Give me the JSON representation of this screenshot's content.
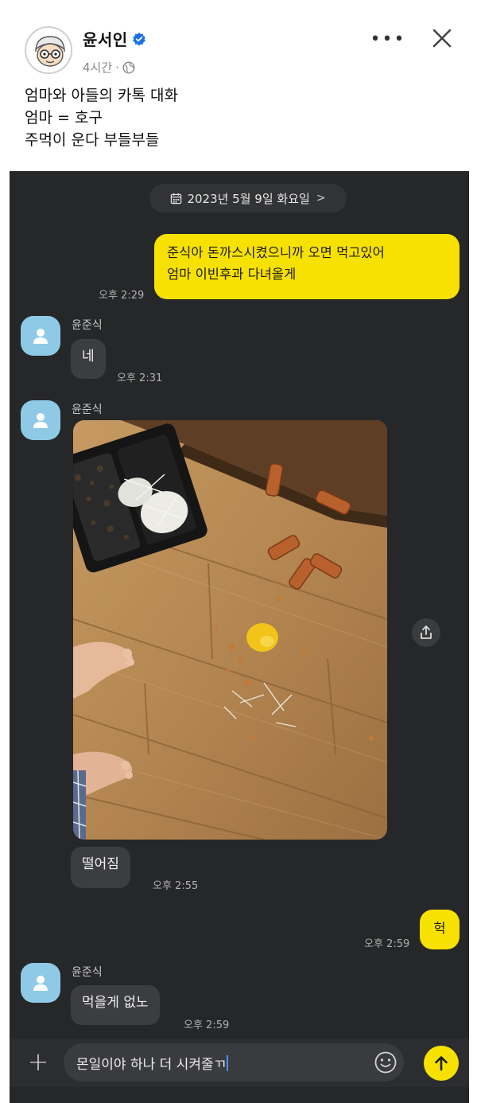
{
  "post": {
    "author": "윤서인",
    "time": "4시간",
    "dot": "·",
    "more": "•••",
    "lines": [
      "엄마와 아들의 카톡 대화",
      "엄마 = 호구",
      "주먹이 운다 부들부들"
    ]
  },
  "chat": {
    "date": "2023년 5월 9일 화요일",
    "date_chevron": ">",
    "messages": [
      {
        "from": "me",
        "text_lines": [
          "준식아 돈까스시켰으니까 오면 먹고있어",
          "엄마 이빈후과 다녀올게"
        ],
        "time": "오후 2:29"
      },
      {
        "from": "윤준식",
        "text": "네",
        "time": "오후 2:31"
      },
      {
        "from": "윤준식",
        "type": "photo"
      },
      {
        "from": "윤준식",
        "text": "떨어짐",
        "time": "오후 2:55"
      },
      {
        "from": "me",
        "text": "헉",
        "time": "오후 2:59"
      },
      {
        "from": "윤준식",
        "text": "먹을게 없노",
        "time": "오후 2:59"
      }
    ]
  },
  "input": {
    "plus": "+",
    "value": "몬일이야 하나 더 시켜줄ㄲ"
  },
  "colors": {
    "chat_bg": "#262729",
    "my_bubble": "#f7e100",
    "other_bubble": "#3c3d40",
    "friend_avatar": "#8ecae6",
    "verified": "#1d6fe6"
  },
  "icons": [
    "verified-badge-icon",
    "globe-icon",
    "more-icon",
    "close-icon",
    "calendar-icon",
    "person-icon",
    "share-icon",
    "plus-icon",
    "emoji-icon",
    "send-arrow-icon"
  ]
}
